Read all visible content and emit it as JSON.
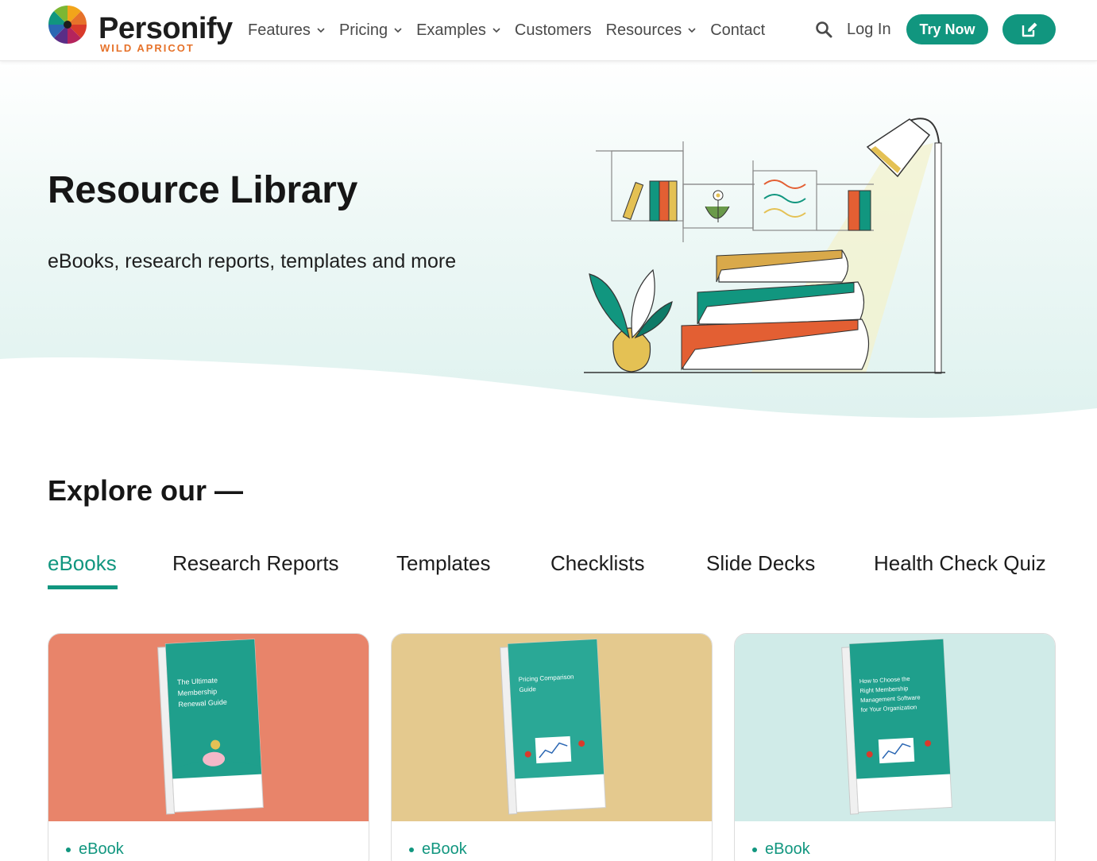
{
  "brand": {
    "name": "Personify",
    "sub": "WILD APRICOT"
  },
  "nav": {
    "items": [
      {
        "label": "Features",
        "dropdown": true
      },
      {
        "label": "Pricing",
        "dropdown": true
      },
      {
        "label": "Examples",
        "dropdown": true
      },
      {
        "label": "Customers",
        "dropdown": false
      },
      {
        "label": "Resources",
        "dropdown": true
      },
      {
        "label": "Contact",
        "dropdown": false
      }
    ],
    "login_label": "Log In",
    "try_label": "Try Now",
    "icons": {
      "search": "search-icon",
      "edit": "edit-icon",
      "chevron": "chevron-down-icon"
    }
  },
  "hero": {
    "title": "Resource Library",
    "subtitle": "eBooks, research reports, templates and more"
  },
  "explore": {
    "heading": "Explore our —",
    "tabs": [
      {
        "label": "eBooks",
        "active": true
      },
      {
        "label": "Research Reports",
        "active": false
      },
      {
        "label": "Templates",
        "active": false
      },
      {
        "label": "Checklists",
        "active": false
      },
      {
        "label": "Slide Decks",
        "active": false
      },
      {
        "label": "Health Check Quiz",
        "active": false
      }
    ]
  },
  "cards": [
    {
      "bg": "#e8846a",
      "book_title_lines": [
        "The Ultimate",
        "Membership",
        "Renewal Guide"
      ],
      "tag": "eBook"
    },
    {
      "bg": "#e4c98e",
      "book_title_lines": [
        "Pricing Comparison",
        "Guide"
      ],
      "tag": "eBook"
    },
    {
      "bg": "#d0ebe8",
      "book_title_lines": [
        "How to Choose the",
        "Right Membership",
        "Management Software",
        "for Your Organization"
      ],
      "tag": "eBook"
    }
  ],
  "colors": {
    "accent": "#11967f",
    "logo_orange": "#e6722a",
    "hero_bg": "#e4f4f2"
  }
}
